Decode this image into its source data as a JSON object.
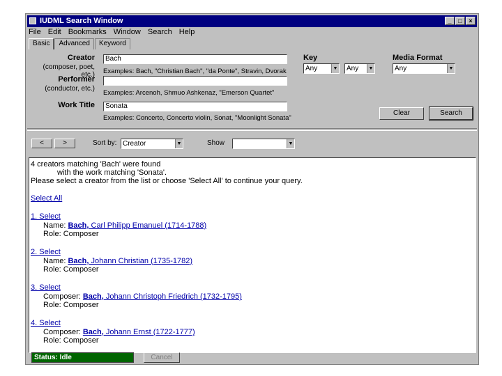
{
  "window": {
    "title": "IUDML Search Window",
    "controls": {
      "minimize": "_",
      "maximize": "□",
      "close": "×"
    }
  },
  "menu": [
    "File",
    "Edit",
    "Bookmarks",
    "Window",
    "Search",
    "Help"
  ],
  "tabs": [
    "Basic",
    "Advanced",
    "Keyword"
  ],
  "form": {
    "creator": {
      "label": "Creator",
      "sub": "(composer, poet, etc.)",
      "value": "Bach",
      "examples": "Examples: Bach, \"Christian Bach\", \"da Ponte\", Stravin, Dvorak"
    },
    "performer": {
      "label": "Performer",
      "sub": "(conductor, etc.)",
      "value": "",
      "examples": "Examples: Arcenoh, Shmuo Ashkenaz, \"Emerson Quartet\""
    },
    "work_title": {
      "label": "Work Title",
      "value": "Sonata",
      "examples": "Examples: Concerto, Concerto violin, Sonat, \"Moonlight Sonata\""
    },
    "key": {
      "label": "Key",
      "select1": "Any",
      "select2": "Any"
    },
    "media_format": {
      "label": "Media Format",
      "value": "Any"
    },
    "clear_label": "Clear",
    "search_label": "Search"
  },
  "toolbar": {
    "back": "<",
    "forward": ">",
    "sort_label": "Sort by:",
    "sort_value": "Creator",
    "show_label": "Show",
    "show_value": ""
  },
  "results": {
    "line1": "4 creators matching 'Bach' were found",
    "line2": "with the work matching 'Sonata'.",
    "line3": "Please select a creator from the list or choose 'Select All' to continue your query.",
    "select_all": "Select All",
    "items": [
      {
        "num": "1. Select",
        "field": "Name:",
        "link_bold": "Bach,",
        "link_rest": " Carl Philipp Emanuel (1714-1788)",
        "role": "Role: Composer"
      },
      {
        "num": "2. Select",
        "field": "Name:",
        "link_bold": "Bach,",
        "link_rest": " Johann Christian (1735-1782)",
        "role": "Role: Composer"
      },
      {
        "num": "3. Select",
        "field": "Composer:",
        "link_bold": "Bach,",
        "link_rest": " Johann Christoph Friedrich (1732-1795)",
        "role": "Role: Composer"
      },
      {
        "num": "4. Select",
        "field": "Composer:",
        "link_bold": "Bach,",
        "link_rest": " Johann Ernst (1722-1777)",
        "role": "Role: Composer"
      }
    ]
  },
  "status": {
    "text": "Status: Idle",
    "cancel": "Cancel"
  }
}
